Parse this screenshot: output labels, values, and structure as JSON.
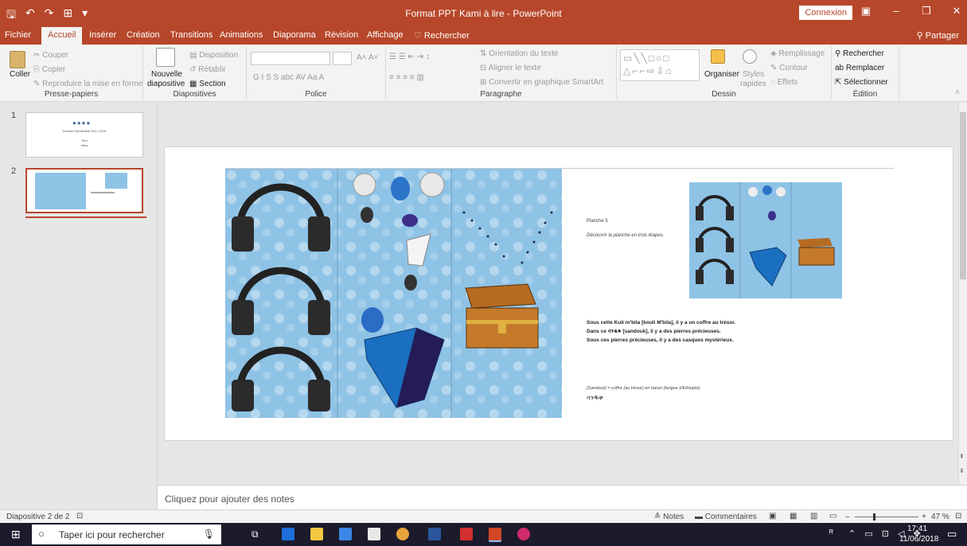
{
  "window": {
    "title": "Format PPT Kami à lire - PowerPoint",
    "signin": "Connexion",
    "minimize": "–",
    "restore": "❐",
    "close": "✕"
  },
  "tabs": [
    "Fichier",
    "Accueil",
    "Insérer",
    "Création",
    "Transitions",
    "Animations",
    "Diaporama",
    "Révision",
    "Affichage",
    "Rechercher"
  ],
  "share": "Partager",
  "ribbon": {
    "clipboard": {
      "label": "Presse-papiers",
      "paste": "Coller",
      "cut": "Couper",
      "copy": "Copier",
      "format_painter": "Reproduire la mise en forme"
    },
    "slides": {
      "label": "Diapositives",
      "new_slide_1": "Nouvelle",
      "new_slide_2": "diapositive",
      "layout": "Disposition",
      "reset": "Rétablir",
      "section": "Section"
    },
    "font": {
      "label": "Police"
    },
    "paragraph": {
      "label": "Paragraphe",
      "text_direction": "Orientation du texte",
      "align_text": "Aligner le texte",
      "smartart": "Convertir en graphique SmartArt"
    },
    "drawing": {
      "label": "Dessin",
      "arrange": "Organiser",
      "quick_styles_1": "Styles",
      "quick_styles_2": "rapides",
      "fill": "Remplissage",
      "outline": "Contour",
      "effects": "Effets"
    },
    "editing": {
      "label": "Édition",
      "find": "Rechercher",
      "replace": "Remplacer",
      "select": "Sélectionner"
    }
  },
  "thumbnails": [
    {
      "number": "1",
      "line1": "Dossier Kamishibaï 2017-2018",
      "line2": "Titre",
      "line3": "Infos"
    },
    {
      "number": "2"
    }
  ],
  "slide": {
    "planche": "Planche 5",
    "instruction": "Découvrir la planche en trois étapes.",
    "line1": "Sous cette Kuli m'bila [kouli M'bila], il y a un coffre au trésor.",
    "line2": "Dans ce ሳንዱቅ [sandouk], il y a des pierres précieuses.",
    "line3": "Sous ces pierres précieuses, il y a des casques mystérieux.",
    "footnote": "[Sandouk] = coffre (au trésor) en harari (langue d'Ethiopie).",
    "script": "ሳንዱቅ"
  },
  "notes_placeholder": "Cliquez pour ajouter des notes",
  "status": {
    "slide_counter": "Diapositive 2 de 2",
    "notes": "Notes",
    "comments": "Commentaires",
    "zoom": "47 %"
  },
  "taskbar": {
    "search_placeholder": "Taper ici pour rechercher",
    "time": "17:41",
    "date": "11/06/2018"
  },
  "colors": {
    "accent": "#b7472a",
    "taskbar": "#1b1b2b",
    "sky": "#8fc3e6"
  }
}
